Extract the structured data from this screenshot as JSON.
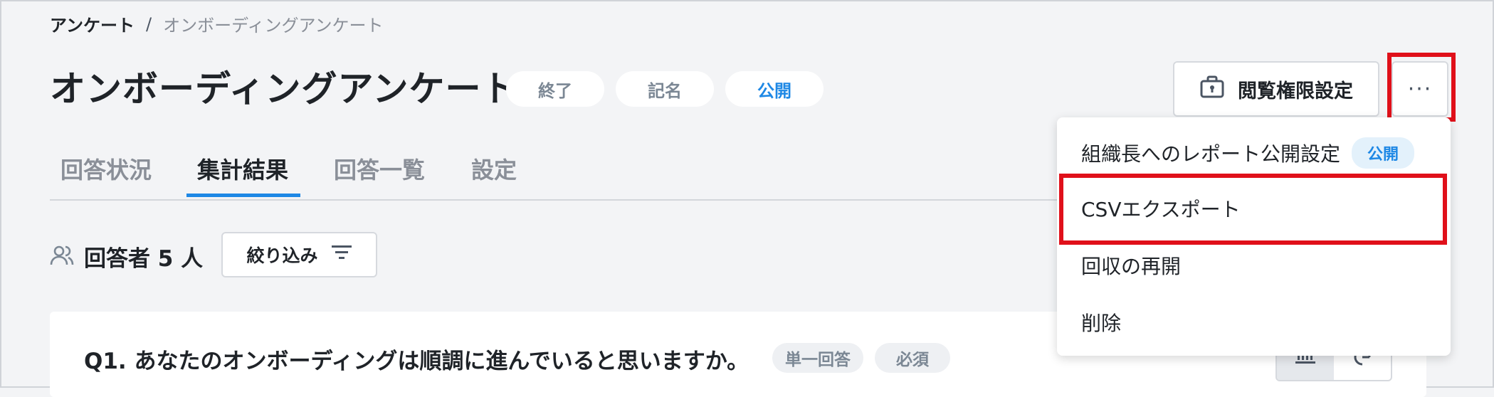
{
  "breadcrumb": {
    "root": "アンケート",
    "separator": "/",
    "current": "オンボーディングアンケート"
  },
  "title": "オンボーディングアンケート",
  "status_pills": [
    {
      "label": "終了"
    },
    {
      "label": "記名"
    },
    {
      "label": "公開"
    }
  ],
  "header_actions": {
    "permissions_label": "閲覧権限設定",
    "more_label": "···"
  },
  "tabs": [
    {
      "label": "回答状況",
      "active": false
    },
    {
      "label": "集計結果",
      "active": true
    },
    {
      "label": "回答一覧",
      "active": false
    },
    {
      "label": "設定",
      "active": false
    }
  ],
  "respondents": {
    "label": "回答者 5 人",
    "filter_label": "絞り込み"
  },
  "question": {
    "title": "Q1. あなたのオンボーディングは順調に進んでいると思いますか。",
    "badges": [
      "単一回答",
      "必須"
    ]
  },
  "dropdown": {
    "items": [
      {
        "label": "組織長へのレポート公開設定",
        "badge": "公開"
      },
      {
        "label": "CSVエクスポート"
      },
      {
        "label": "回収の再開"
      },
      {
        "label": "削除"
      }
    ]
  },
  "colors": {
    "accent": "#1e88e5",
    "highlight": "#e0101a",
    "background": "#f3f4f6"
  }
}
